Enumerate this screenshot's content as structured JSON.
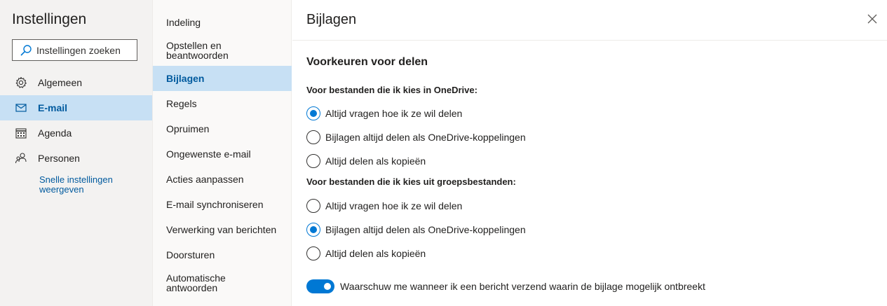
{
  "sidebar": {
    "title": "Instellingen",
    "search": {
      "placeholder": "Instellingen zoeken"
    },
    "items": [
      {
        "label": "Algemeen",
        "icon": "gear-icon",
        "active": false
      },
      {
        "label": "E-mail",
        "icon": "mail-icon",
        "active": true
      },
      {
        "label": "Agenda",
        "icon": "calendar-icon",
        "active": false
      },
      {
        "label": "Personen",
        "icon": "people-icon",
        "active": false
      }
    ],
    "quick_settings_label": "Snelle instellingen weergeven"
  },
  "submenu": {
    "items": [
      {
        "label": "Indeling"
      },
      {
        "label": "Opstellen en beantwoorden"
      },
      {
        "label": "Bijlagen",
        "active": true
      },
      {
        "label": "Regels"
      },
      {
        "label": "Opruimen"
      },
      {
        "label": "Ongewenste e-mail"
      },
      {
        "label": "Acties aanpassen"
      },
      {
        "label": "E-mail synchroniseren"
      },
      {
        "label": "Verwerking van berichten"
      },
      {
        "label": "Doorsturen"
      },
      {
        "label": "Automatische antwoorden"
      }
    ]
  },
  "main": {
    "title": "Bijlagen",
    "section_title": "Voorkeuren voor delen",
    "onedrive": {
      "label": "Voor bestanden die ik kies in OneDrive:",
      "options": [
        {
          "label": "Altijd vragen hoe ik ze wil delen",
          "selected": true
        },
        {
          "label": "Bijlagen altijd delen als OneDrive-koppelingen",
          "selected": false
        },
        {
          "label": "Altijd delen als kopieën",
          "selected": false
        }
      ]
    },
    "group_files": {
      "label": "Voor bestanden die ik kies uit groepsbestanden:",
      "options": [
        {
          "label": "Altijd vragen hoe ik ze wil delen",
          "selected": false
        },
        {
          "label": "Bijlagen altijd delen als OneDrive-koppelingen",
          "selected": true
        },
        {
          "label": "Altijd delen als kopieën",
          "selected": false
        }
      ]
    },
    "warn_toggle": {
      "label": "Waarschuw me wanneer ik een bericht verzend waarin de bijlage mogelijk ontbreekt",
      "on": true
    }
  },
  "colors": {
    "accent": "#0078d4",
    "active_bg": "#c7e0f4",
    "active_text": "#005a9e"
  }
}
